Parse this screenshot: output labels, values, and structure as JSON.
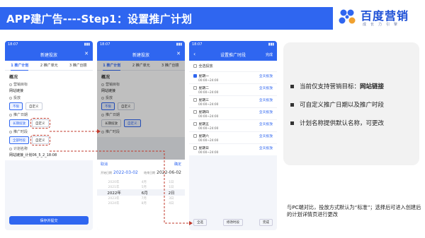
{
  "header": {
    "title": "APP建广告----Step1：设置推广计划"
  },
  "brand": {
    "name": "百度营销",
    "slogan": "成长力引擎"
  },
  "colors": {
    "primary": "#2f66f0",
    "annotation": "#c0392b"
  },
  "phone1": {
    "time": "18:07",
    "nav_title": "新建投放",
    "tabs": [
      "1 推广计划",
      "2 推广单元",
      "3 推广创意"
    ],
    "section": "概况",
    "goal_label": "营销目标",
    "goal_value": "网站链接",
    "promo_label": "投放",
    "promo_chips": [
      "不限",
      "自定义"
    ],
    "date_label": "推广日期",
    "date_chips": [
      "长期投放",
      "自定义"
    ],
    "slot_label": "推广时段",
    "slot_chips": [
      "全部时段",
      "自定义"
    ],
    "plan_label": "计划名称",
    "plan_value": "网站链接_计划06_5_2_18:08",
    "save": "保存并提交"
  },
  "phone2": {
    "time": "18:07",
    "nav_title": "新建投放",
    "tabs": [
      "1 推广计划",
      "2 推广单元",
      "3 推广创意"
    ],
    "section": "概况",
    "goal_label": "营销目标",
    "goal_value": "网站链接",
    "promo_label": "投放",
    "promo_chips": [
      "不限",
      "自定义"
    ],
    "date_label": "推广日期",
    "date_chips": [
      "长期投放",
      "自定义"
    ],
    "slot_label": "推广时段",
    "picker": {
      "cancel": "取消",
      "confirm": "确定",
      "start_label": "开始日期",
      "start": "2022-03-02",
      "end_label": "结束日期",
      "end": "2022-06-02",
      "rows": [
        [
          "2020年",
          "4月",
          "1日"
        ],
        [
          "2021年",
          "5月",
          "1日"
        ],
        [
          "2022年",
          "6月",
          "2日"
        ],
        [
          "2023年",
          "7月",
          "3日"
        ],
        [
          "2024年",
          "8月",
          "4日"
        ]
      ]
    }
  },
  "phone3": {
    "time": "18:07",
    "nav_title": "设置推广时段",
    "done": "完成",
    "list_head": "全选投放",
    "days": [
      {
        "name": "星期一",
        "time": "00:00~24:00",
        "allday": "全天投放",
        "on": true
      },
      {
        "name": "星期二",
        "time": "00:00~24:00",
        "allday": "全天投放",
        "on": false
      },
      {
        "name": "星期三",
        "time": "00:00~24:00",
        "allday": "全天投放",
        "on": false
      },
      {
        "name": "星期四",
        "time": "00:00~24:00",
        "allday": "全天投放",
        "on": false
      },
      {
        "name": "星期五",
        "time": "00:00~24:00",
        "allday": "全天投放",
        "on": false
      },
      {
        "name": "星期六",
        "time": "00:00~24:00",
        "allday": "全天投放",
        "on": false
      },
      {
        "name": "星期日",
        "time": "00:00~24:00",
        "allday": "全天投放",
        "on": false
      }
    ],
    "bottom_left": "全选",
    "bottom_mid": "修改时段",
    "bottom_right": "完成"
  },
  "info": {
    "items": [
      {
        "text": "当前仅支持营销目标：",
        "bold": "网站链接"
      },
      {
        "text": "可自定义推广日期以及推广时段",
        "bold": ""
      },
      {
        "text": "计划名称提供默认名称，可更改",
        "bold": ""
      }
    ]
  },
  "note": "与PC端对比，投放方式默认为“标准”；选择后可进入创建后的计划详情页进行更改"
}
